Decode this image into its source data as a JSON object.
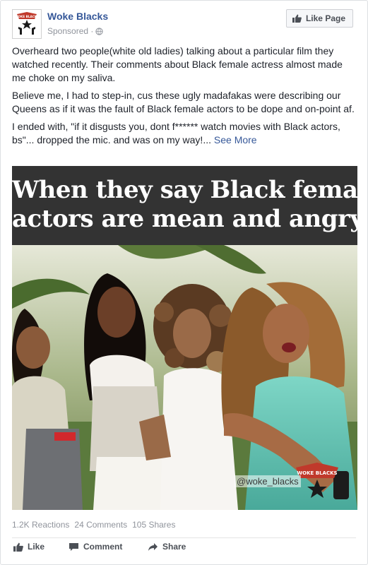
{
  "page": {
    "name": "Woke Blacks",
    "sponsored": "Sponsored ·",
    "like_page_label": "Like Page",
    "avatar_text": "WOKE BLACKS"
  },
  "post": {
    "paragraphs": [
      "Overheard two people(white old ladies) talking about a particular film they watched recently. Their comments about Black female actress almost made me choke on my saliva.",
      "Believe me, I had to step-in, cus these ugly madafakas were describing our Queens as if it was the fault of Black female actors to be dope and on-point af.",
      "I ended with, \"if it disgusts you, dont f****** watch movies with Black actors, bs\"... dropped the mic. and was on my way!..."
    ],
    "see_more": "See More"
  },
  "media": {
    "banner_line1": "When they say Black female",
    "banner_line2": "actors are mean and angry",
    "watermark": "@woke_blacks",
    "logo_text": "WOKE BLACKS"
  },
  "stats": {
    "reactions": "1.2K Reactions",
    "comments": "24 Comments",
    "shares": "105 Shares"
  },
  "actions": {
    "like": "Like",
    "comment": "Comment",
    "share": "Share"
  },
  "colors": {
    "link": "#365899",
    "meta": "#90949c",
    "banner": "#333333"
  }
}
